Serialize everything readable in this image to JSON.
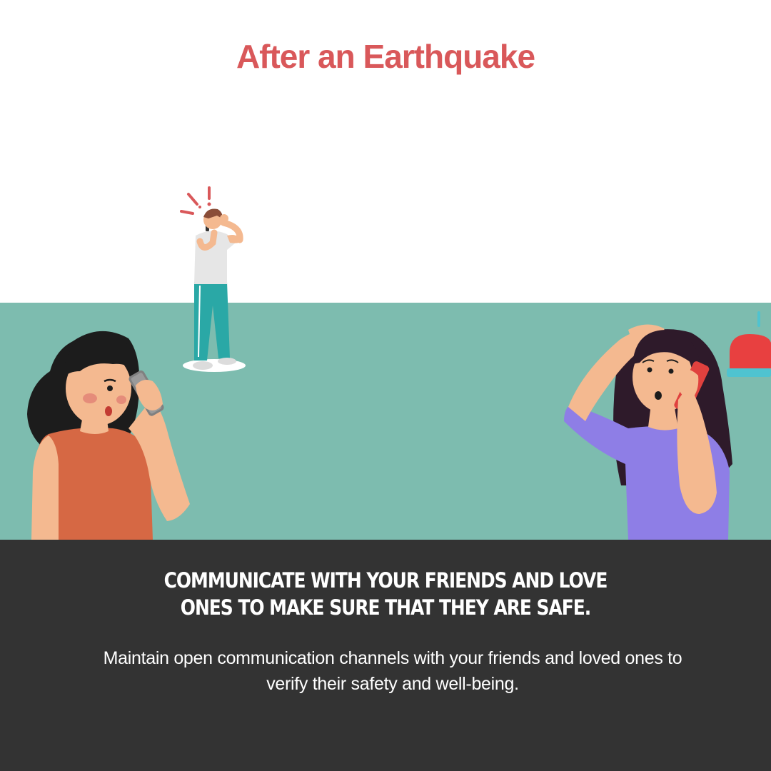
{
  "title": "After an Earthquake",
  "headline": "Communicate with your friends and love ones to make sure that they are safe.",
  "body": "Maintain open communication channels with your friends and loved ones to verify their safety and well-being.",
  "colors": {
    "title": "#d9585a",
    "band": "#7dbcaf",
    "footer": "#333333",
    "text": "#ffffff"
  },
  "icons": [
    "worried-man-on-phone-illustration",
    "woman-on-phone-illustration",
    "worried-woman-on-phone-illustration",
    "siren-icon"
  ]
}
